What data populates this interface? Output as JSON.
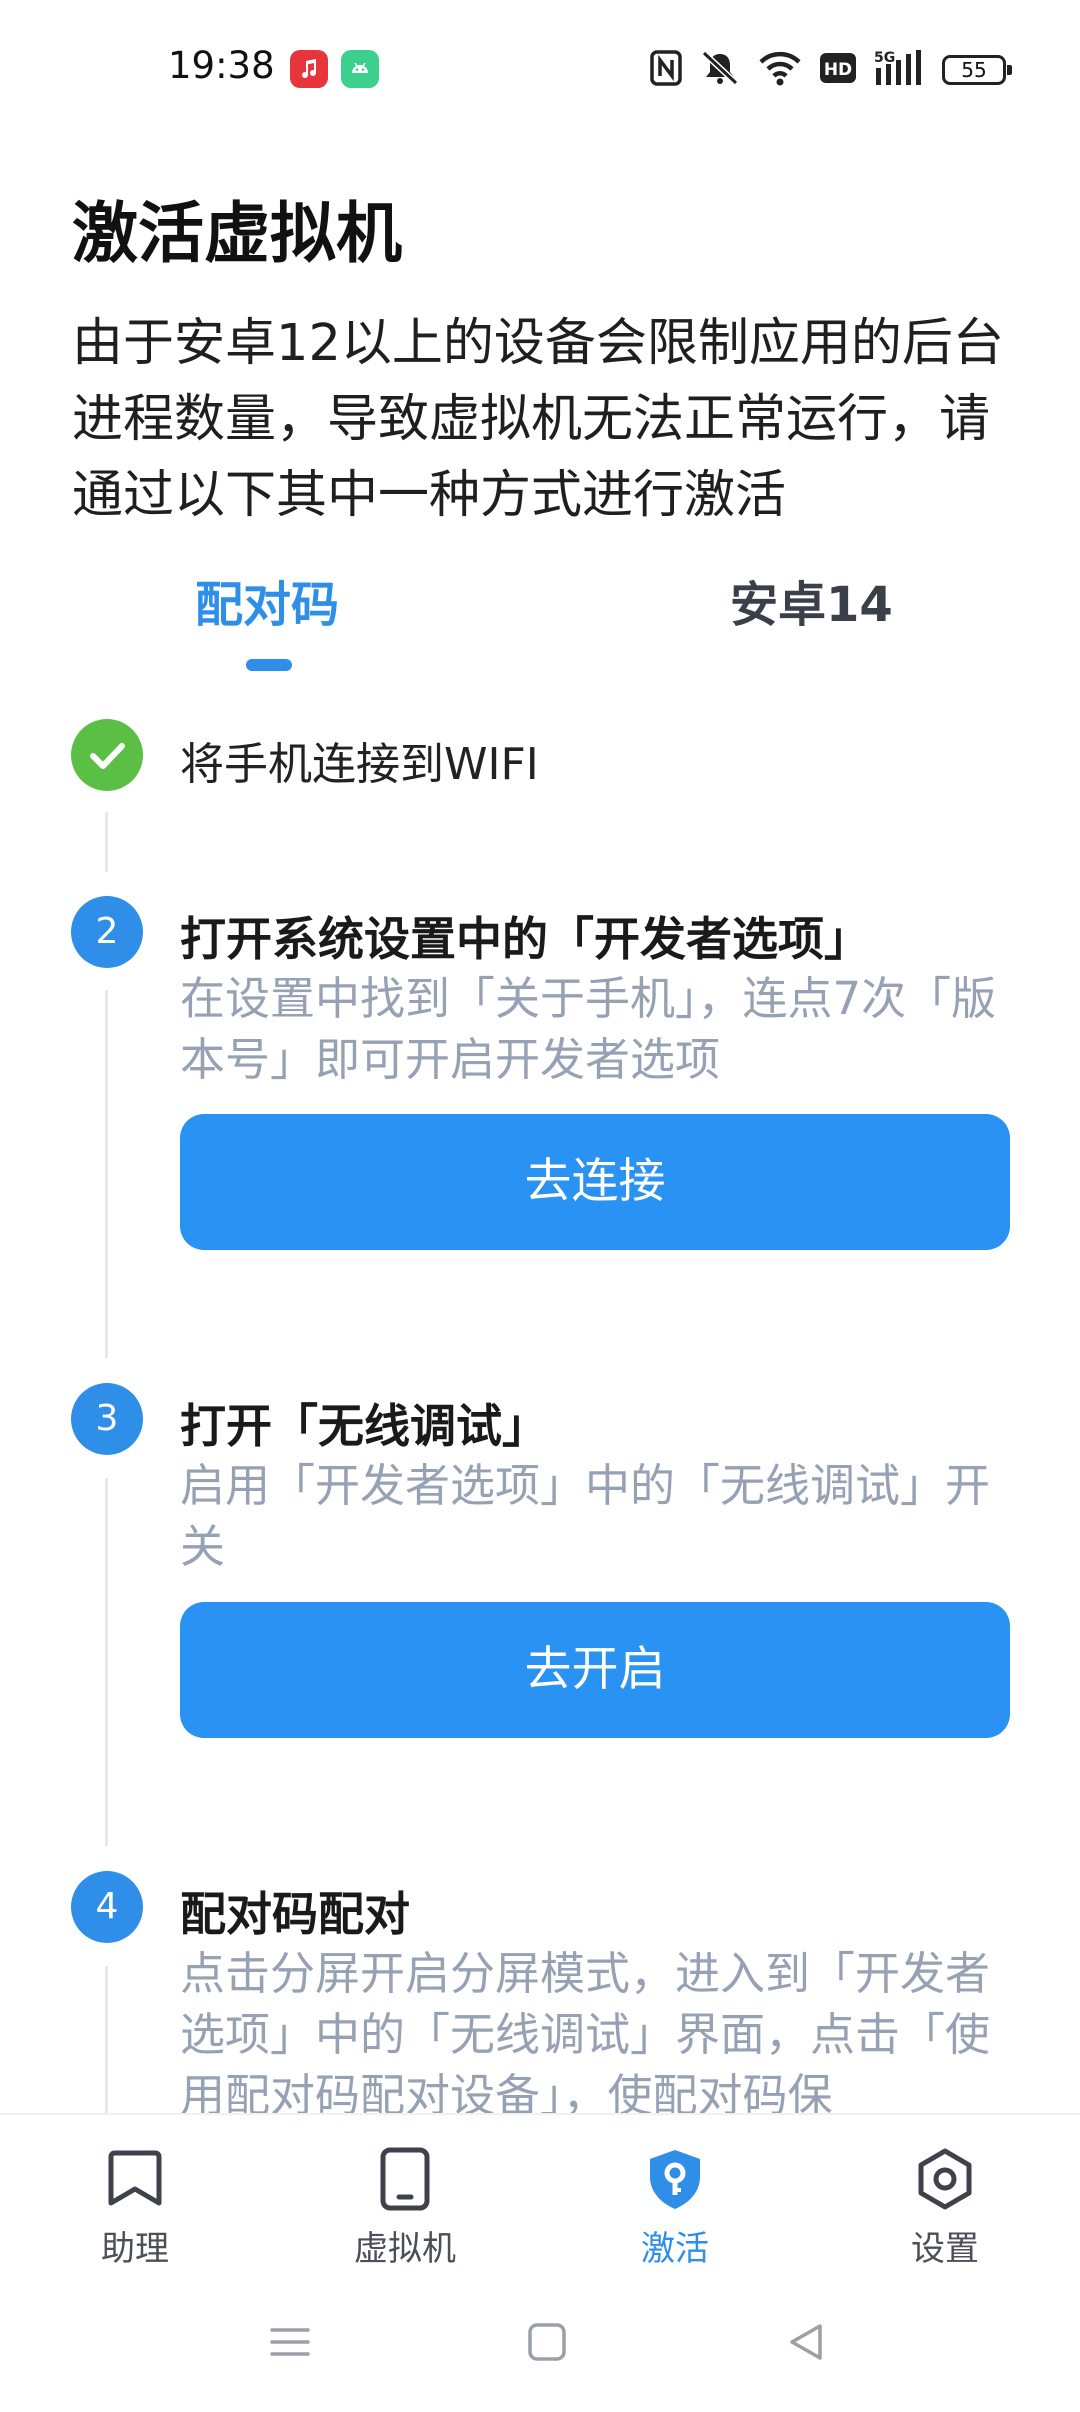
{
  "status_bar": {
    "time": "19:38",
    "battery": "55",
    "app_icons": [
      "music-app-icon",
      "android-app-icon"
    ],
    "icons": [
      "nfc-icon",
      "mute-icon",
      "wifi-icon",
      "hd-icon",
      "signal-5g-icon",
      "battery-icon"
    ]
  },
  "header": {
    "title": "激活虚拟机",
    "description": "由于安卓12以上的设备会限制应用的后台进程数量，导致虚拟机无法正常运行，请通过以下其中一种方式进行激活"
  },
  "tabs": [
    {
      "label": "配对码",
      "active": true
    },
    {
      "label": "安卓14",
      "active": false
    }
  ],
  "steps": [
    {
      "number": "",
      "title": "将手机连接到WIFI",
      "done": true
    },
    {
      "number": "2",
      "title": "打开系统设置中的「开发者选项」",
      "description": "在设置中找到「关于手机」，连点7次「版本号」即可开启开发者选项",
      "button": "去连接"
    },
    {
      "number": "3",
      "title": "打开「无线调试」",
      "description": "启用「开发者选项」中的「无线调试」开关",
      "button": "去开启"
    },
    {
      "number": "4",
      "title": "配对码配对",
      "description": "点击分屏开启分屏模式，进入到「开发者选项」中的「无线调试」界面，点击「使用配对码配对设备」，使配对码保"
    }
  ],
  "bottom_nav": [
    {
      "label": "助理",
      "icon": "bookmark-icon",
      "active": false
    },
    {
      "label": "虚拟机",
      "icon": "phone-icon",
      "active": false
    },
    {
      "label": "激活",
      "icon": "shield-key-icon",
      "active": true
    },
    {
      "label": "设置",
      "icon": "gear-icon",
      "active": false
    }
  ],
  "colors": {
    "accent": "#2e8ee8",
    "button": "#2a92f2",
    "done": "#5bbf45",
    "muted_text": "#96a1b4"
  }
}
